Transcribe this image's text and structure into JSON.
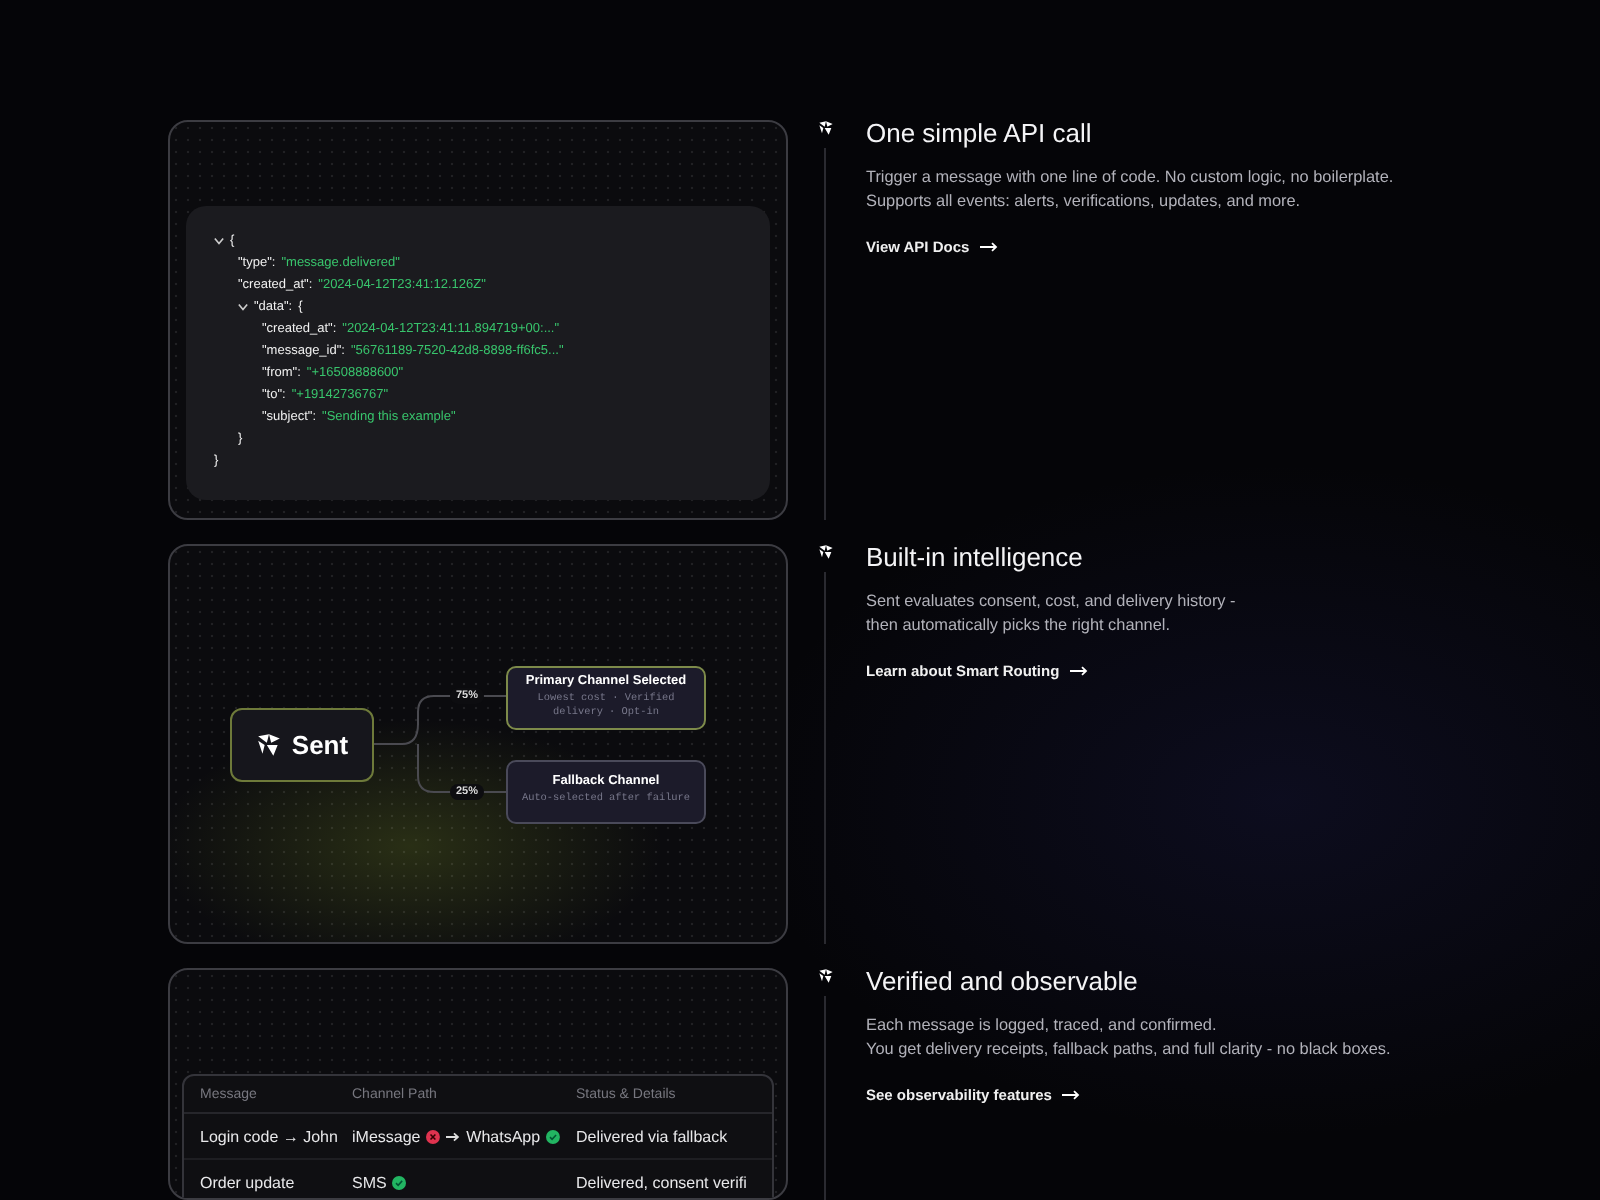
{
  "sections": [
    {
      "title": "One simple API call",
      "description": "Trigger a message with one line of code. No custom logic, no boilerplate.\nSupports all events: alerts, verifications, updates, and more.",
      "link": "View API Docs",
      "panel": {
        "kind": "code",
        "root": {
          "open": "{",
          "expanded": true,
          "close": "}",
          "children": [
            {
              "key": "\"type\":",
              "value": "\"message.delivered\""
            },
            {
              "key": "\"created_at\":",
              "value": "\"2024-04-12T23:41:12.126Z\""
            },
            {
              "key": "\"data\":",
              "open": "{",
              "expanded": true,
              "close": "}",
              "children": [
                {
                  "key": "\"created_at\":",
                  "value": "\"2024-04-12T23:41:11.894719+00:...\""
                },
                {
                  "key": "\"message_id\":",
                  "value": "\"56761189-7520-42d8-8898-ff6fc5...\""
                },
                {
                  "key": "\"from\":",
                  "value": "\"+16508888600\""
                },
                {
                  "key": "\"to\":",
                  "value": "\"+19142736767\""
                },
                {
                  "key": "\"subject\":",
                  "value": "\"Sending this example\""
                }
              ]
            }
          ]
        }
      }
    },
    {
      "title": "Built-in intelligence",
      "description": "Sent evaluates consent, cost, and delivery history -\nthen automatically picks the right channel.",
      "link": "Learn about Smart Routing",
      "panel": {
        "kind": "routing",
        "source": "Sent",
        "routes": [
          {
            "share": "75%",
            "title": "Primary Channel Selected",
            "detail": "Lowest cost · Verified delivery · Opt-in"
          },
          {
            "share": "25%",
            "title": "Fallback Channel",
            "detail": "Auto-selected after failure"
          }
        ]
      }
    },
    {
      "title": "Verified and observable",
      "description": "Each message is logged, traced, and confirmed.\nYou get delivery receipts, fallback paths, and full clarity - no black boxes.",
      "link": "See observability features",
      "panel": {
        "kind": "table",
        "columns": [
          "Message",
          "Channel Path",
          "Status & Details"
        ],
        "rows": [
          {
            "message": "Login code → John",
            "path": [
              {
                "channel": "iMessage",
                "failed": true
              },
              {
                "channel": "WhatsApp",
                "failed": false
              }
            ],
            "status": "Delivered via fallback"
          },
          {
            "message": "Order update",
            "path": [
              {
                "channel": "SMS",
                "failed": false
              }
            ],
            "status": "Delivered, consent verifi"
          }
        ]
      }
    }
  ]
}
